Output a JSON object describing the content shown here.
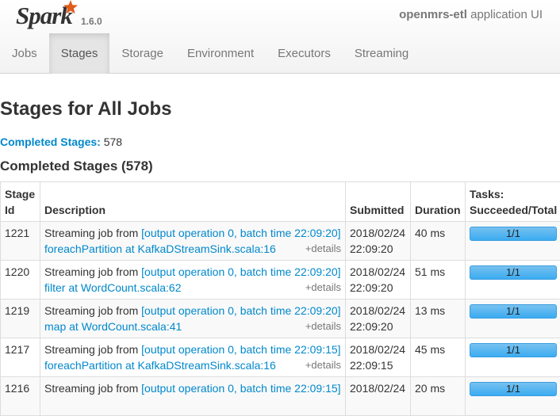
{
  "brand": {
    "name": "Spark",
    "version": "1.6.0"
  },
  "app": {
    "name": "openmrs-etl",
    "suffix": " application UI"
  },
  "tabs": [
    "Jobs",
    "Stages",
    "Storage",
    "Environment",
    "Executors",
    "Streaming"
  ],
  "active_tab": "Stages",
  "page_title": "Stages for All Jobs",
  "summary": {
    "label": "Completed Stages:",
    "value": "578"
  },
  "section_title": "Completed Stages (578)",
  "table": {
    "headers": {
      "stage_id": "Stage Id",
      "description": "Description",
      "submitted": "Submitted",
      "duration": "Duration",
      "tasks": "Tasks: Succeeded/Total"
    },
    "rows": [
      {
        "id": "1221",
        "prefix": "Streaming job from ",
        "link": "[output operation 0, batch time 22:09:20]",
        "op": "foreachPartition at KafkaDStreamSink.scala:16",
        "details": "+details",
        "submitted_date": "2018/02/24",
        "submitted_time": "22:09:20",
        "duration": "40 ms",
        "tasks": "1/1",
        "tasks_fraction": 1.0
      },
      {
        "id": "1220",
        "prefix": "Streaming job from ",
        "link": "[output operation 0, batch time 22:09:20]",
        "op": "filter at WordCount.scala:62",
        "details": "+details",
        "submitted_date": "2018/02/24",
        "submitted_time": "22:09:20",
        "duration": "51 ms",
        "tasks": "1/1",
        "tasks_fraction": 1.0
      },
      {
        "id": "1219",
        "prefix": "Streaming job from ",
        "link": "[output operation 0, batch time 22:09:20]",
        "op": "map at WordCount.scala:41",
        "details": "+details",
        "submitted_date": "2018/02/24",
        "submitted_time": "22:09:20",
        "duration": "13 ms",
        "tasks": "1/1",
        "tasks_fraction": 1.0
      },
      {
        "id": "1217",
        "prefix": "Streaming job from ",
        "link": "[output operation 0, batch time 22:09:15]",
        "op": "foreachPartition at KafkaDStreamSink.scala:16",
        "details": "+details",
        "submitted_date": "2018/02/24",
        "submitted_time": "22:09:15",
        "duration": "45 ms",
        "tasks": "1/1",
        "tasks_fraction": 1.0
      },
      {
        "id": "1216",
        "prefix": "Streaming job from ",
        "link": "[output operation 0, batch time 22:09:15]",
        "op": "",
        "details": "",
        "submitted_date": "2018/02/24",
        "submitted_time": "",
        "duration": "20 ms",
        "tasks": "1/1",
        "tasks_fraction": 1.0
      }
    ]
  },
  "colors": {
    "link": "#0088cc",
    "progress": "#3bacf1",
    "brand_star": "#e25a1c"
  },
  "icons": {
    "brand_star": "star-icon"
  }
}
